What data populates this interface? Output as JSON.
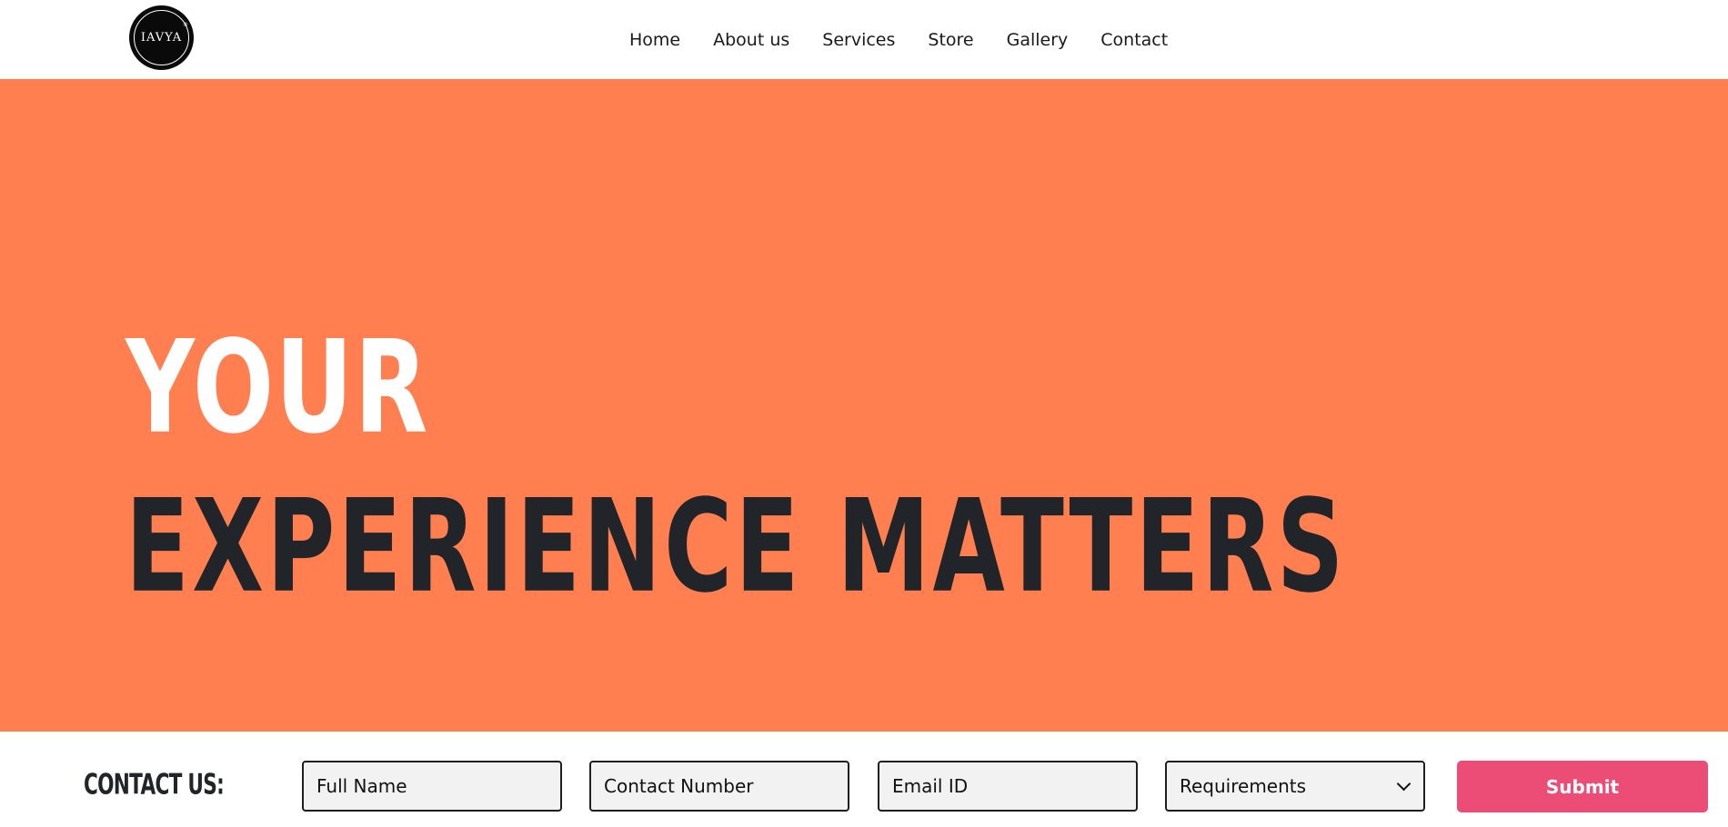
{
  "brand": {
    "logo_text": "IAVYA",
    "logo_mark": "®"
  },
  "nav": {
    "items": [
      "Home",
      "About us",
      "Services",
      "Store",
      "Gallery",
      "Contact"
    ]
  },
  "hero": {
    "line1": "YOUR",
    "line2": "EXPERIENCE MATTERS",
    "background_color": "#ff7f50"
  },
  "contact_bar": {
    "label": "CONTACT US:",
    "full_name_placeholder": "Full Name",
    "contact_number_placeholder": "Contact Number",
    "email_placeholder": "Email ID",
    "requirements_selected": "Requirements",
    "submit_label": "Submit",
    "submit_color": "#ec4d77"
  }
}
